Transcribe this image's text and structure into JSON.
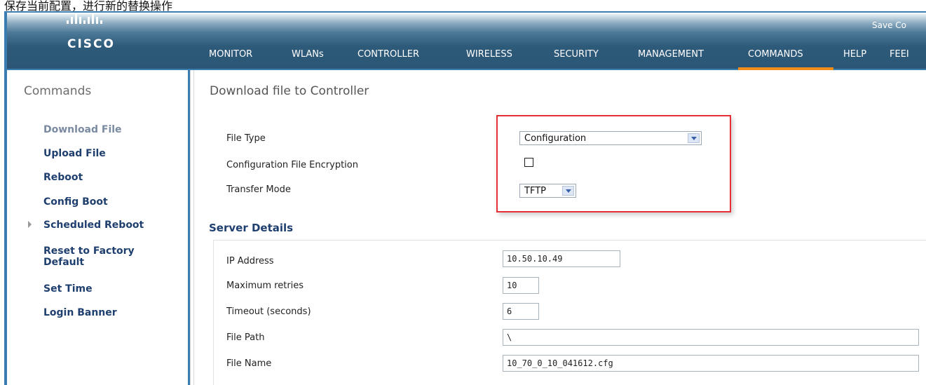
{
  "top_caption": "保存当前配置，进行新的替换操作",
  "header": {
    "logo_text": "CISCO",
    "save_link": "Save Co",
    "nav": [
      {
        "label": "MONITOR",
        "active": false
      },
      {
        "label": "WLANs",
        "active": false
      },
      {
        "label": "CONTROLLER",
        "active": false
      },
      {
        "label": "WIRELESS",
        "active": false
      },
      {
        "label": "SECURITY",
        "active": false
      },
      {
        "label": "MANAGEMENT",
        "active": false
      },
      {
        "label": "COMMANDS",
        "active": true
      },
      {
        "label": "HELP",
        "active": false
      },
      {
        "label": "FEEI",
        "active": false
      }
    ],
    "active_color": "#f28c1a"
  },
  "sidebar": {
    "title": "Commands",
    "items": [
      {
        "label": "Download File",
        "active": true
      },
      {
        "label": "Upload File"
      },
      {
        "label": "Reboot"
      },
      {
        "label": "Config Boot"
      },
      {
        "label": "Scheduled Reboot",
        "expandable": true
      },
      {
        "label": "Reset to Factory Default"
      },
      {
        "label": "Set Time"
      },
      {
        "label": "Login Banner"
      }
    ]
  },
  "main": {
    "title": "Download file to Controller",
    "file_type": {
      "label": "File Type",
      "value": "Configuration"
    },
    "encryption": {
      "label": "Configuration File Encryption",
      "checked": false
    },
    "transfer_mode": {
      "label": "Transfer Mode",
      "value": "TFTP"
    },
    "server_section": "Server Details",
    "ip_address": {
      "label": "IP Address",
      "value": "10.50.10.49"
    },
    "max_retries": {
      "label": "Maximum retries",
      "value": "10"
    },
    "timeout": {
      "label": "Timeout (seconds)",
      "value": "6"
    },
    "file_path": {
      "label": "File Path",
      "value": "\\"
    },
    "file_name": {
      "label": "File Name",
      "value": "10_70_0_10_041612.cfg"
    }
  },
  "highlight_color": "#e53038"
}
